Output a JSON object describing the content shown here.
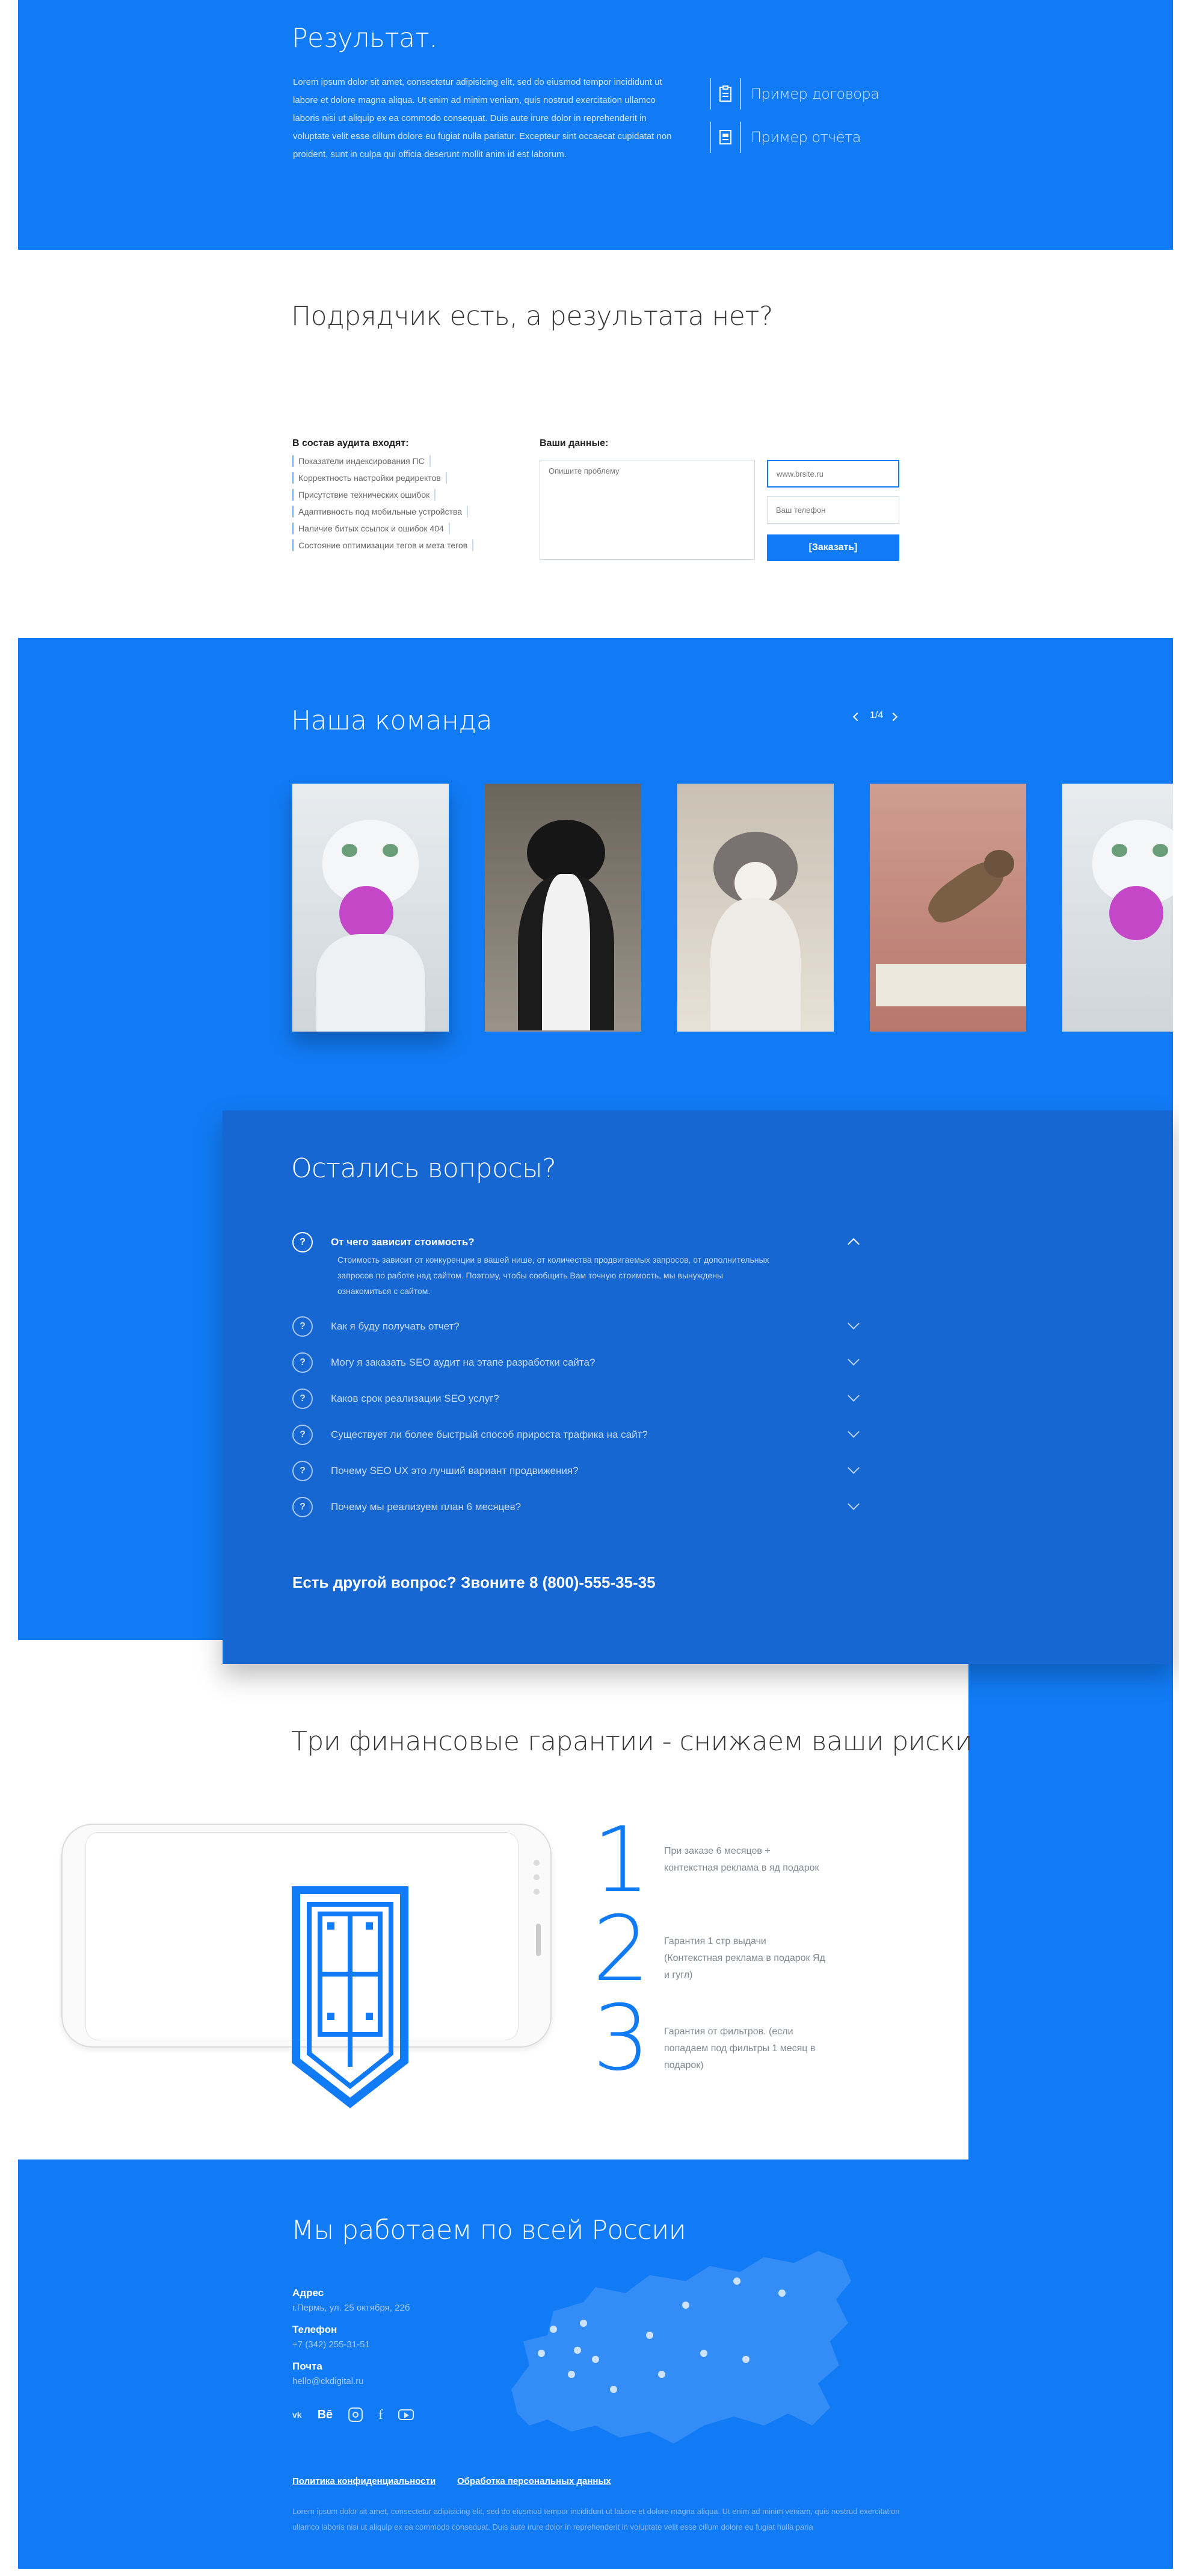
{
  "result": {
    "title": "Результат.",
    "text": "Lorem ipsum dolor sit amet, consectetur adipisicing elit, sed do eiusmod tempor incididunt ut labore et dolore magna aliqua. Ut enim ad minim veniam, quis nostrud exercitation ullamco laboris nisi ut aliquip ex ea commodo consequat. Duis aute irure dolor in reprehenderit in voluptate velit esse cillum dolore eu fugiat nulla pariatur. Excepteur sint occaecat cupidatat non proident, sunt in culpa qui officia deserunt mollit anim id est laborum.",
    "link_contract": "Пример договора",
    "link_report": "Пример отчёта"
  },
  "audit": {
    "title": "Подрядчик есть, а результата нет?",
    "list_title": "В состав аудита входят:",
    "items": [
      "Показатели индексирования ПС",
      "Корректность настройки редиректов",
      "Присутствие технических ошибок",
      "Адаптивность под мобильные устройства",
      "Наличие битых ссылок и ошибок 404",
      "Состояние оптимизации тегов и мета тегов"
    ],
    "form_title": "Ваши данные:",
    "problem_placeholder": "Опишите проблему",
    "site_placeholder": "www.brsite.ru",
    "phone_placeholder": "Ваш телефон",
    "submit": "[Заказать]"
  },
  "team": {
    "title": "Наша команда",
    "pager": "1/4"
  },
  "faq": {
    "title": "Остались вопросы?",
    "open_question": "От чего зависит стоимость?",
    "open_answer": "Стоимость зависит от конкуренции в вашей нише, от количества продвигаемых запросов, от дополнительных запросов по работе над сайтом. Поэтому, чтобы сообщить Вам точную стоимость, мы вынуждены ознакомиться с сайтом.",
    "questions": [
      "Как я буду получать отчет?",
      "Могу я заказать SEO аудит на этапе разработки сайта?",
      "Каков срок реализации SEO услуг?",
      "Существует ли более быстрый способ прироста трафика на сайт?",
      "Почему SEO UX это лучший вариант продвижения?",
      "Почему мы реализуем план 6 месяцев?"
    ],
    "call": "Есть другой вопрос? Звоните 8 (800)-555-35-35"
  },
  "guarantees": {
    "title": "Три финансовые гарантии - снижаем ваши риски",
    "items": [
      {
        "num": "1",
        "text": "При заказе 6 месяцев + контекстная реклама в яд подарок"
      },
      {
        "num": "2",
        "text": "Гарантия 1 стр выдачи (Контекстная реклама в подарок Яд и гугл)"
      },
      {
        "num": "3",
        "text": "Гарантия от фильтров. (если попадаем под фильтры 1 месяц в подарок)"
      }
    ]
  },
  "contacts": {
    "title": "Мы работаем по всей России",
    "address_label": "Адрес",
    "address": "г.Пермь, ул. 25 октября, 22б",
    "phone_label": "Телефон",
    "phone": "+7 (342) 255-31-51",
    "mail_label": "Почта",
    "mail": "hello@ckdigital.ru",
    "social": [
      "vk-icon",
      "behance-icon",
      "instagram-icon",
      "facebook-icon",
      "youtube-icon"
    ],
    "privacy": "Политика конфиденциальности",
    "personal": "Обработка персональных данных",
    "footer_text": "Lorem ipsum dolor sit amet, consectetur adipisicing elit, sed do eiusmod tempor incididunt ut labore et dolore magna aliqua. Ut enim ad minim veniam, quis nostrud exercitation ullamco laboris nisi ut aliquip ex ea commodo consequat. Duis aute irure dolor in reprehenderit in voluptate velit esse cillum dolore eu fugiat nulla paria"
  },
  "colors": {
    "accent": "#117bf5",
    "dark_accent": "#1667d2"
  }
}
